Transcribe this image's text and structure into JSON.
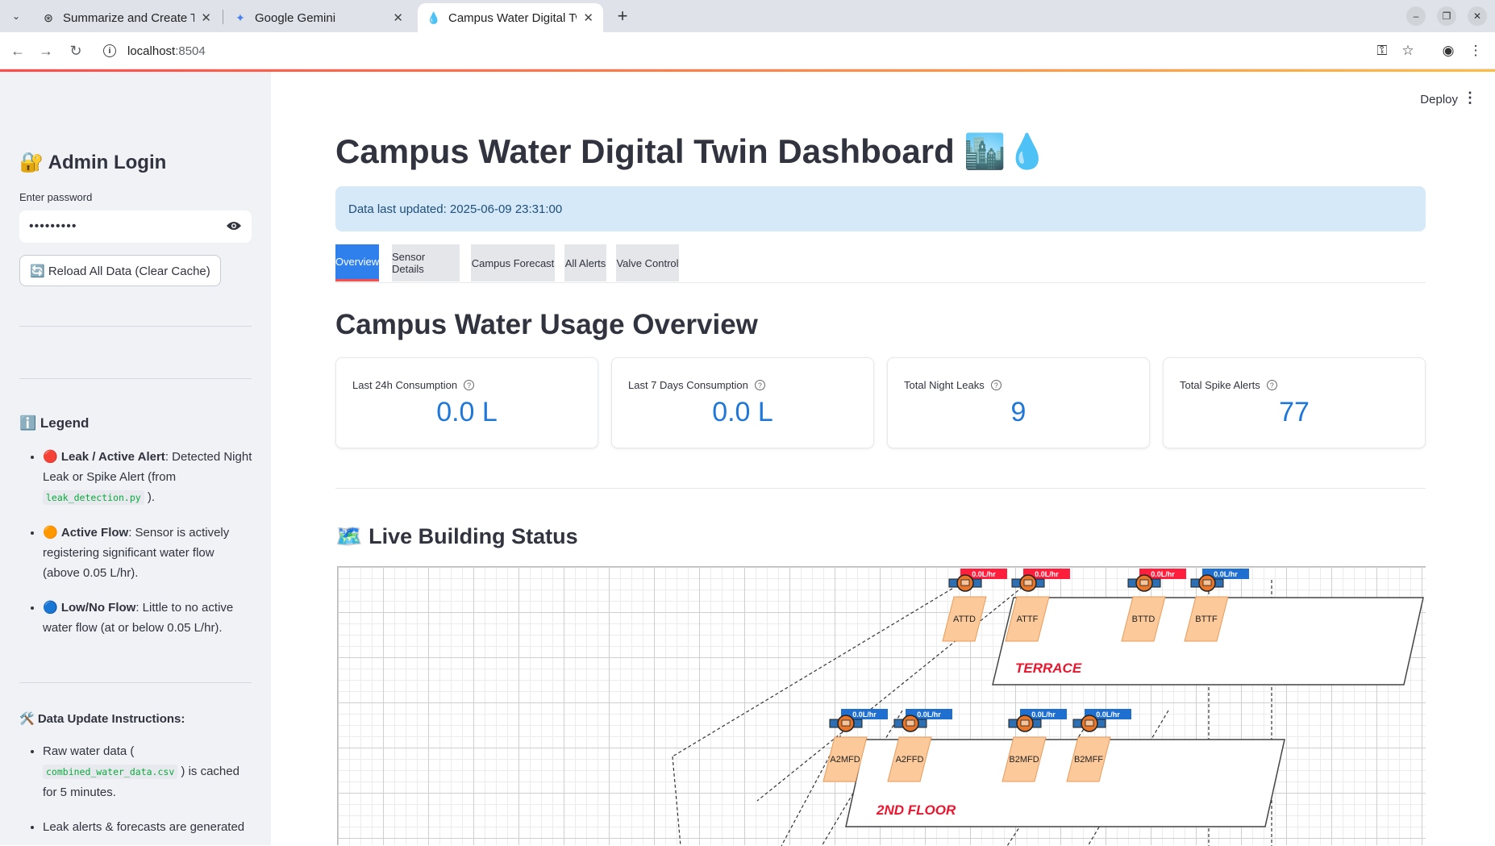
{
  "browser": {
    "tabs": [
      {
        "title": "Summarize and Create T",
        "icon": "openai-icon"
      },
      {
        "title": "Google Gemini",
        "icon": "gemini-icon"
      },
      {
        "title": "Campus Water Digital Tw",
        "icon": "water-drop-icon"
      }
    ],
    "url_host": "localhost",
    "url_port": ":8504"
  },
  "sidebar": {
    "title": "🔐 Admin Login",
    "password_label": "Enter password",
    "password_value": "•••••••••",
    "reload_button": "🔄 Reload All Data (Clear Cache)",
    "legend_title": "ℹ️ Legend",
    "legend": [
      {
        "emoji": "🔴",
        "bold": "Leak / Active Alert",
        "text": ": Detected Night Leak or Spike Alert (from ",
        "code": "leak_detection.py",
        "tail": " )."
      },
      {
        "emoji": "🟠",
        "bold": "Active Flow",
        "text": ": Sensor is actively registering significant water flow (above 0.05 L/hr).",
        "code": "",
        "tail": ""
      },
      {
        "emoji": "🔵",
        "bold": "Low/No Flow",
        "text": ": Little to no active water flow (at or below 0.05 L/hr).",
        "code": "",
        "tail": ""
      }
    ],
    "instructions_title": "🛠️ Data Update Instructions:",
    "instructions": [
      {
        "text": "Raw water data ( ",
        "code": "combined_water_data.csv",
        "tail": " ) is cached for 5 minutes."
      },
      {
        "text": "Leak alerts & forecasts are generated",
        "code": "",
        "tail": ""
      }
    ]
  },
  "header": {
    "deploy_label": "Deploy"
  },
  "main": {
    "title": "Campus Water Digital Twin Dashboard 🏙️💧",
    "info": "Data last updated: 2025-06-09 23:31:00",
    "tabs": [
      "Overview",
      "Sensor Details",
      "Campus Forecast",
      "All Alerts",
      "Valve Control"
    ],
    "section_title": "Campus Water Usage Overview",
    "metrics": [
      {
        "label": "Last 24h Consumption",
        "value": "0.0 L"
      },
      {
        "label": "Last 7 Days Consumption",
        "value": "0.0 L"
      },
      {
        "label": "Total Night Leaks",
        "value": "9"
      },
      {
        "label": "Total Spike Alerts",
        "value": "77"
      }
    ],
    "live_title": "🗺️ Live Building Status",
    "floors": [
      {
        "name": "TERRACE",
        "sensors": [
          {
            "id": "ATTD",
            "reading": "0.0L/hr",
            "status": "leak"
          },
          {
            "id": "ATTF",
            "reading": "0.0L/hr",
            "status": "leak"
          },
          {
            "id": "BTTD",
            "reading": "0.0L/hr",
            "status": "leak"
          },
          {
            "id": "BTTF",
            "reading": "0.0L/hr",
            "status": "low"
          }
        ]
      },
      {
        "name": "2ND FLOOR",
        "sensors": [
          {
            "id": "A2MFD",
            "reading": "0.0L/hr",
            "status": "low"
          },
          {
            "id": "A2FFD",
            "reading": "0.0L/hr",
            "status": "low"
          },
          {
            "id": "B2MFD",
            "reading": "0.0L/hr",
            "status": "low"
          },
          {
            "id": "B2MFF",
            "reading": "0.0L/hr",
            "status": "low"
          }
        ]
      }
    ],
    "colors": {
      "leak": "#ff1f3d",
      "low": "#1f6fd1",
      "accent": "#2f80ed",
      "metric": "#1f77d9"
    }
  }
}
